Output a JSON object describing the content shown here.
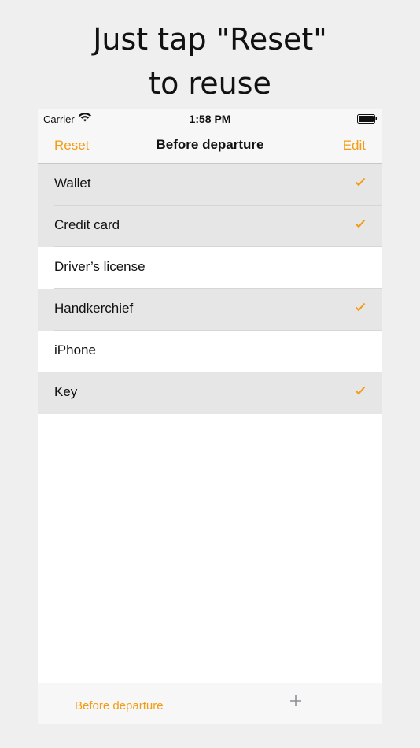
{
  "promo": {
    "line1": "Just tap \"Reset\"",
    "line2": "to reuse"
  },
  "status_bar": {
    "carrier": "Carrier",
    "time": "1:58 PM",
    "wifi_icon": "wifi-icon",
    "battery_icon": "battery-icon"
  },
  "nav": {
    "left": "Reset",
    "title": "Before departure",
    "right": "Edit"
  },
  "items": [
    {
      "label": "Wallet",
      "checked": true
    },
    {
      "label": "Credit card",
      "checked": true
    },
    {
      "label": "Driver’s license",
      "checked": false
    },
    {
      "label": "Handkerchief",
      "checked": true
    },
    {
      "label": "iPhone",
      "checked": false
    },
    {
      "label": "Key",
      "checked": true
    }
  ],
  "tab_bar": {
    "item": "Before departure",
    "add_icon": "plus-icon"
  },
  "colors": {
    "accent": "#f39c12",
    "checked_row": "#e6e6e6",
    "background": "#efefef"
  }
}
